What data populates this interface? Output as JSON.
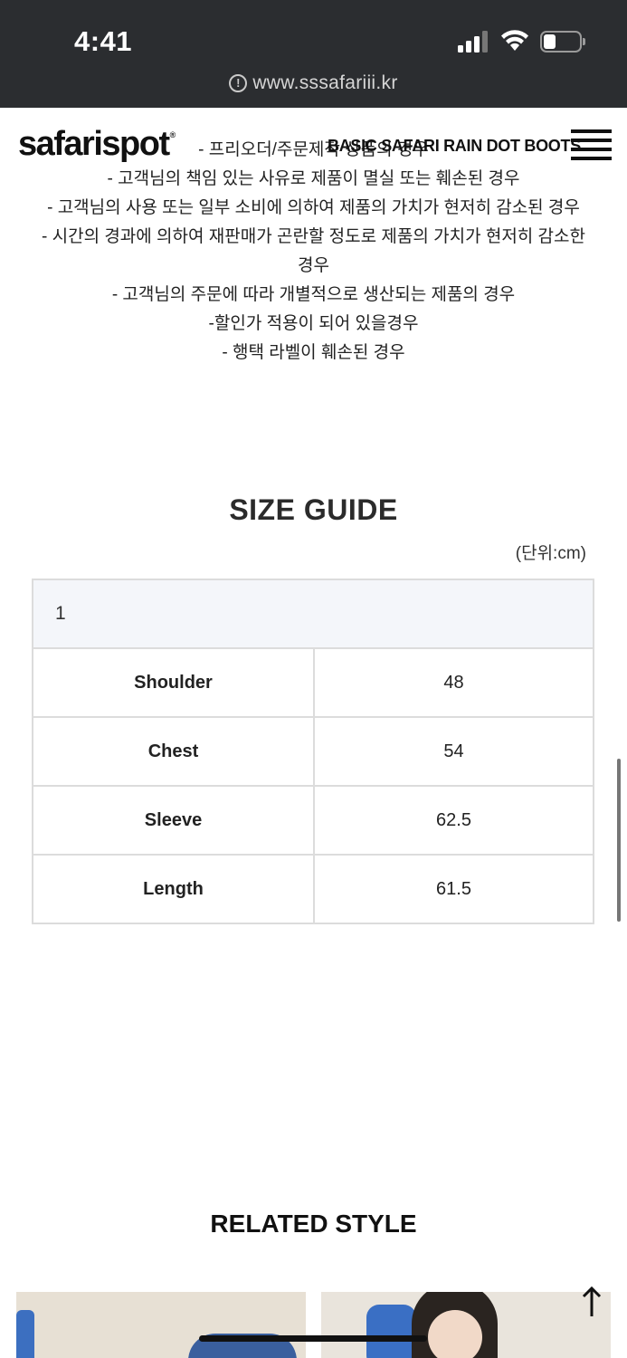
{
  "status_bar": {
    "time": "4:41",
    "signal_icon": "cellular-signal-icon",
    "wifi_icon": "wifi-icon",
    "battery_icon": "battery-icon",
    "battery_level": 0.35
  },
  "browser": {
    "url": "www.sssafariii.kr",
    "info_icon": "info-icon"
  },
  "header": {
    "logo_text": "safarispot",
    "logo_mark": "®",
    "product_title": "BASIC SAFARI RAIN DOT BOOTS",
    "menu_icon": "hamburger-menu-icon"
  },
  "notice_lines": [
    "- 프리오더/주문제작 상품의 경우",
    "- 고객님의 책임 있는 사유로 제품이 멸실 또는 훼손된 경우",
    "- 고객님의 사용 또는 일부 소비에 의하여 제품의 가치가 현저히 감소된 경우",
    "- 시간의 경과에 의하여 재판매가 곤란할 정도로 제품의 가치가 현저히 감소한",
    "경우",
    "- 고객님의 주문에 따라 개별적으로 생산되는 제품의 경우",
    "-할인가 적용이 되어 있을경우",
    "- 행택 라벨이 훼손된 경우"
  ],
  "size_guide": {
    "title": "SIZE GUIDE",
    "unit": "(단위:cm)",
    "size_header": "1",
    "rows": [
      {
        "label": "Shoulder",
        "value": "48"
      },
      {
        "label": "Chest",
        "value": "54"
      },
      {
        "label": "Sleeve",
        "value": "62.5"
      },
      {
        "label": "Length",
        "value": "61.5"
      }
    ]
  },
  "related": {
    "title": "RELATED STYLE",
    "scroll_top_icon": "arrow-up-icon"
  },
  "colors": {
    "chrome_bg": "#2b2d30",
    "table_header_bg": "#f4f6fa",
    "table_border": "#dcdcdc"
  }
}
